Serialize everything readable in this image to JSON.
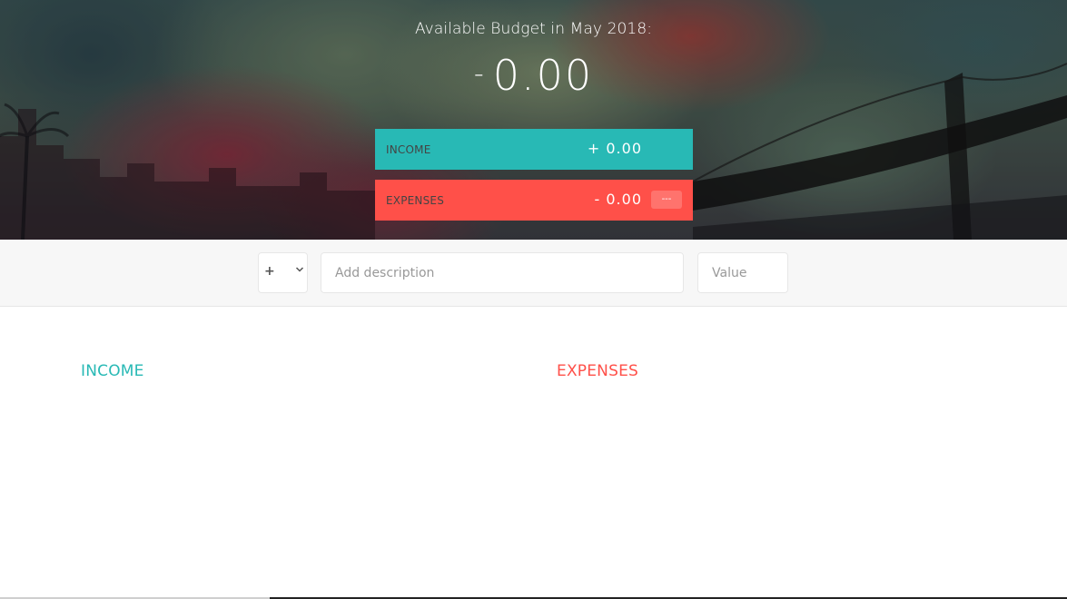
{
  "budget": {
    "title": "Available Budget in May 2018:",
    "sign": "-",
    "value": "0.00"
  },
  "summary": {
    "income": {
      "label": "Income",
      "value": "+ 0.00",
      "color": "#28b9b5"
    },
    "expenses": {
      "label": "Expenses",
      "value": "- 0.00",
      "percentage": "---",
      "color": "#ff5049"
    }
  },
  "add": {
    "type_selected": "+",
    "description_placeholder": "Add description",
    "value_placeholder": "Value"
  },
  "lists": {
    "income_title": "Income",
    "expenses_title": "Expenses"
  }
}
